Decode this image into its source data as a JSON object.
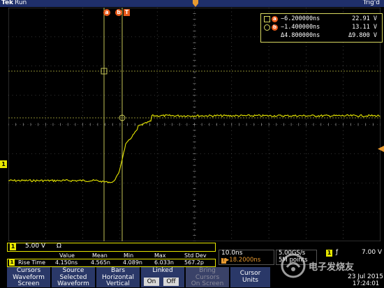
{
  "header": {
    "brand": "Tek",
    "state": "Run",
    "trigger_status": "Trig'd"
  },
  "cursor_tags": {
    "a": "a",
    "b": "b",
    "t": "T"
  },
  "cursor_readout": {
    "row_a": {
      "label": "a",
      "time": "−6.200000ns",
      "volt": "22.91 V"
    },
    "row_b": {
      "label": "b",
      "time": "−1.400000ns",
      "volt": "13.11 V"
    },
    "row_delta": {
      "time": "Δ4.800000ns",
      "volt": "Δ9.800 V"
    }
  },
  "channel": {
    "number": "1",
    "scale": "5.00 V",
    "coupling": "Ω"
  },
  "measurement": {
    "headers": [
      "Value",
      "Mean",
      "Min",
      "Max",
      "Std Dev"
    ],
    "name": "Rise Time",
    "values": [
      "4.150ns",
      "4.565n",
      "4.089n",
      "6.033n",
      "567.2p"
    ]
  },
  "timebase": {
    "scale": "10.0ns",
    "position": "18.2000ns",
    "sample_rate_a": "5.00GS/s",
    "sample_rate_b": "5M points"
  },
  "trigger": {
    "channel": "1",
    "edge": "ƒ",
    "level": "7.00 V"
  },
  "clock": {
    "date": "23 Jul 2015",
    "time": "17:24:01"
  },
  "softkeys": [
    {
      "lines": [
        "Cursors",
        "Waveform",
        "Screen"
      ]
    },
    {
      "lines": [
        "Source",
        "Selected",
        "Waveform"
      ]
    },
    {
      "lines": [
        "Bars",
        "Horizontal",
        "Vertical"
      ]
    },
    {
      "lines": [
        "Linked"
      ],
      "on": "On",
      "off": "Off"
    },
    {
      "lines": [
        "Bring",
        "Cursors",
        "On Screen"
      ]
    },
    {
      "lines": [
        "Cursor",
        "Units"
      ]
    }
  ],
  "watermark_text": "电子发烧友",
  "colors": {
    "trace": "#e8e800",
    "cursor": "#e85a1a",
    "menu_bg": "#2a3868",
    "status_bar": "#1f2f6a"
  }
}
